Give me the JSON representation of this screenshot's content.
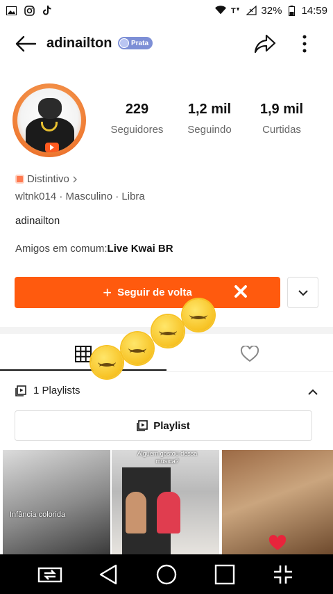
{
  "status_bar": {
    "battery": "32%",
    "time": "14:59"
  },
  "header": {
    "username": "adinailton",
    "badge": "Prata"
  },
  "stats": [
    {
      "value": "229",
      "label": "Seguidores"
    },
    {
      "value": "1,2 mil",
      "label": "Seguindo"
    },
    {
      "value": "1,9 mil",
      "label": "Curtidas"
    }
  ],
  "profile": {
    "distintivo": "Distintivo",
    "meta": "wltnk014 · Masculino · Libra",
    "bio": "adinailton",
    "friends_label": "Amigos em comum:",
    "friends_value": "Live Kwai BR"
  },
  "actions": {
    "follow_label": "Seguir de volta",
    "follow_plus": "+"
  },
  "playlists": {
    "header": "1 Playlists",
    "button_label": "Playlist"
  },
  "thumbnails": [
    {
      "caption": "Infância colorida"
    },
    {
      "caption": "Alguem gostou dessa musica?"
    },
    {
      "caption": ""
    }
  ],
  "colors": {
    "accent": "#ff5a0e",
    "badge": "#7d8fd6"
  }
}
